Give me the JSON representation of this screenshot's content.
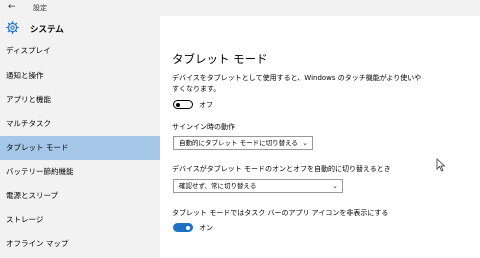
{
  "titlebar": {
    "back_icon": "←",
    "title": "設定"
  },
  "sidebar": {
    "header": "システム",
    "items": [
      {
        "label": "ディスプレイ"
      },
      {
        "label": "通知と操作"
      },
      {
        "label": "アプリと機能"
      },
      {
        "label": "マルチタスク"
      },
      {
        "label": "タブレット モード",
        "active": true
      },
      {
        "label": "バッテリー節約機能"
      },
      {
        "label": "電源とスリープ"
      },
      {
        "label": "ストレージ"
      },
      {
        "label": "オフライン マップ"
      }
    ]
  },
  "main": {
    "title": "タブレット モード",
    "description": "デバイスをタブレットとして使用すると、Windows のタッチ機能がより使いやすくなります。",
    "toggle1_state": "オフ",
    "signin_label": "サインイン時の動作",
    "signin_value": "自動的にタブレット モードに切り替える",
    "switch_label": "デバイスがタブレット モードのオンとオフを自動的に切り替えるとき",
    "switch_value": "確認せず、常に切り替える",
    "hide_label": "タブレット モードではタスク バーのアプリ アイコンを非表示にする",
    "toggle2_state": "オン"
  },
  "colors": {
    "accent": "#1e73c8",
    "selected_nav": "#a6c8e8",
    "sidebar_bg": "#f2f2f2"
  }
}
